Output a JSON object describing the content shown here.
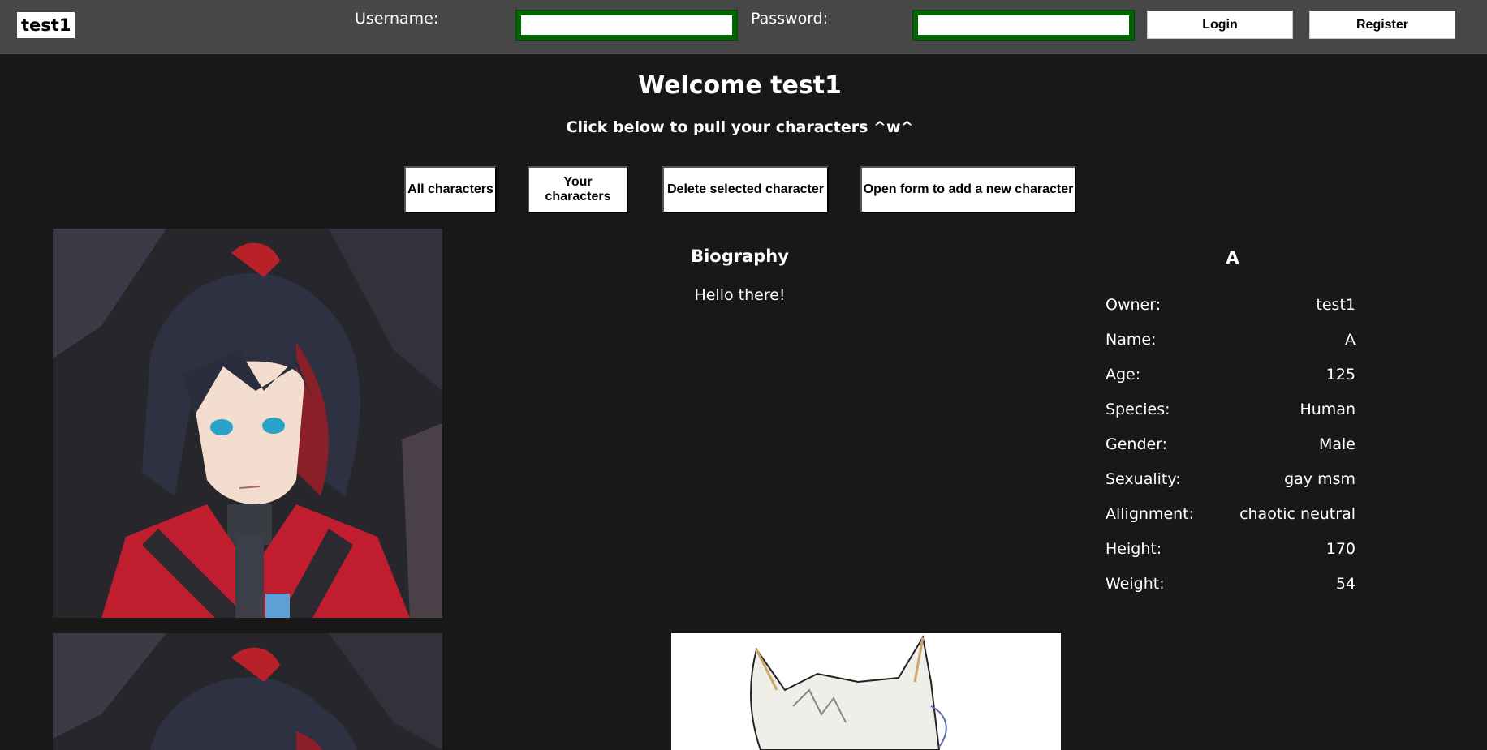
{
  "header": {
    "logo": "test1",
    "username_label": "Username:",
    "username_value": "",
    "password_label": "Password:",
    "password_value": "",
    "login_label": "Login",
    "register_label": "Register"
  },
  "main": {
    "welcome": "Welcome test1",
    "subtitle": "Click below to pull your characters ^w^",
    "actions": [
      "All characters",
      "Your characters",
      "Delete selected character",
      "Open form to add a new character"
    ]
  },
  "character": {
    "biography_title": "Biography",
    "biography_text": "Hello there!",
    "name_title": "A",
    "stats": [
      {
        "label": "Owner:",
        "value": "test1"
      },
      {
        "label": "Name:",
        "value": "A"
      },
      {
        "label": "Age:",
        "value": "125"
      },
      {
        "label": "Species:",
        "value": "Human"
      },
      {
        "label": "Gender:",
        "value": "Male"
      },
      {
        "label": "Sexuality:",
        "value": "gay msm"
      },
      {
        "label": "Allignment:",
        "value": "chaotic neutral"
      },
      {
        "label": "Height:",
        "value": "170"
      },
      {
        "label": "Weight:",
        "value": "54"
      }
    ]
  },
  "colors": {
    "background": "#181818",
    "topbar": "#474747",
    "input_border": "#006400"
  },
  "icons": {
    "portrait": "character-portrait-image",
    "second_portrait": "character-sketch-image"
  }
}
